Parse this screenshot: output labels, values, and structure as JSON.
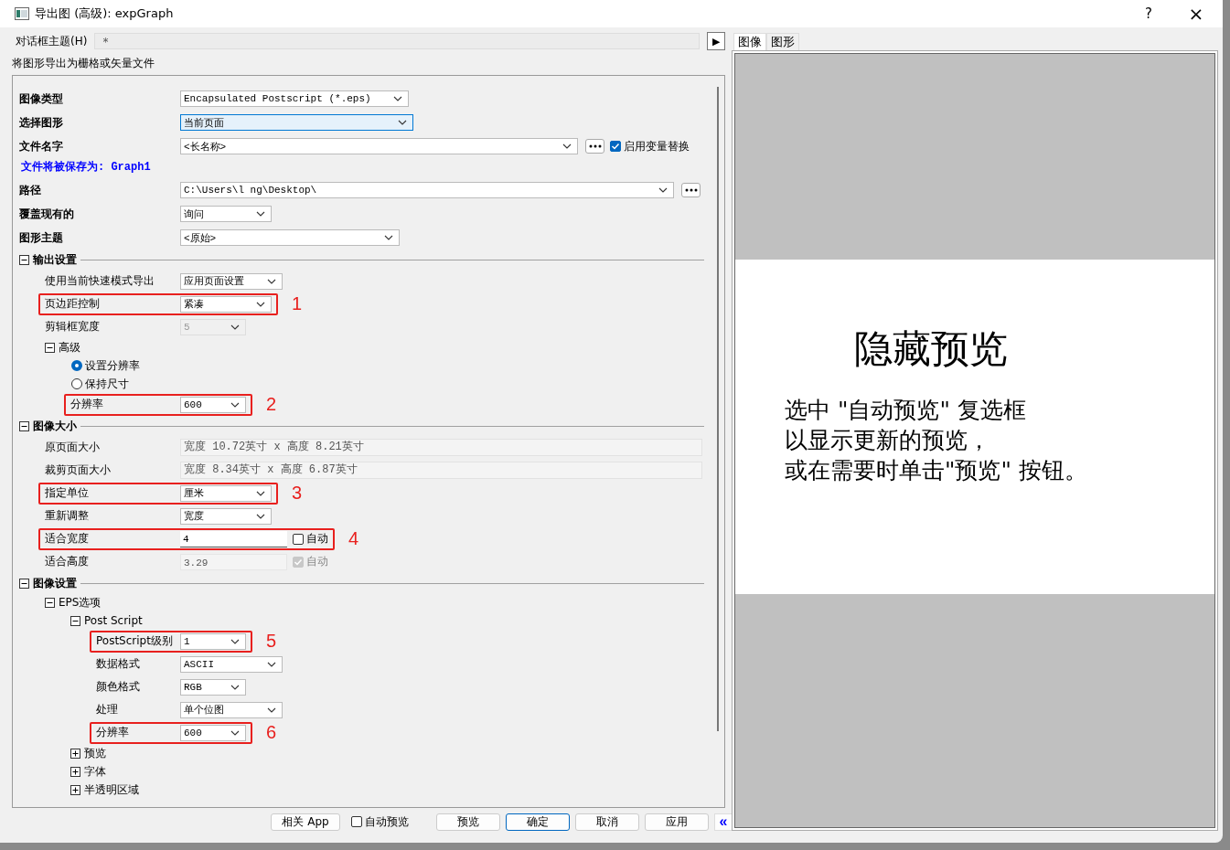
{
  "window": {
    "title": "导出图 (高级): expGraph",
    "help_button": "?",
    "close_button": "×"
  },
  "theme_row": {
    "label": "对话框主题(H)",
    "value": "*",
    "arrow": "▶"
  },
  "description": "将图形导出为栅格或矢量文件",
  "fields": [
    {
      "kind": "dropdown",
      "label": "图像类型",
      "value": "Encapsulated Postscript (*.eps)",
      "focused": false
    },
    {
      "kind": "dropdown",
      "label": "选择图形",
      "value": "当前页面",
      "focused": true
    },
    {
      "kind": "browse",
      "label": "文件名字",
      "value": "<长名称>",
      "option": {
        "label": "启用变量替换",
        "checked": true
      }
    },
    {
      "kind": "note",
      "text": "文件将被保存为: Graph1"
    },
    {
      "kind": "browse",
      "label": "路径",
      "value": "C:\\Users\\l  ng\\Desktop\\"
    },
    {
      "kind": "dropdown",
      "label": "覆盖现有的",
      "value": "询问",
      "focused": false
    },
    {
      "kind": "dropdown",
      "label": "图形主题",
      "value": "<原始>",
      "focused": false
    }
  ],
  "tree": [
    {
      "kind": "group",
      "label": "输出设置",
      "expanded": true,
      "children": [
        {
          "kind": "dropdown",
          "label": "使用当前快速模式导出",
          "value": "应用页面设置",
          "disabled": false
        },
        {
          "kind": "dropdown",
          "label": "页边距控制",
          "value": "紧凑",
          "disabled": false,
          "callout": "1"
        },
        {
          "kind": "dropdown",
          "label": "剪辑框宽度",
          "value": "5",
          "disabled": true
        },
        {
          "kind": "group",
          "label": "高级",
          "expanded": true,
          "children": [
            {
              "kind": "radio",
              "label": "设置分辨率",
              "selected": true
            },
            {
              "kind": "radio",
              "label": "保持尺寸",
              "selected": false
            },
            {
              "kind": "dropdown",
              "label": "分辨率",
              "value": "600",
              "disabled": false,
              "callout": "2"
            }
          ]
        }
      ]
    },
    {
      "kind": "group",
      "label": "图像大小",
      "expanded": true,
      "children": [
        {
          "kind": "readonly",
          "label": "原页面大小",
          "value": "宽度 10.72英寸 x 高度 8.21英寸"
        },
        {
          "kind": "readonly",
          "label": "裁剪页面大小",
          "value": "宽度 8.34英寸 x 高度 6.87英寸"
        },
        {
          "kind": "dropdown",
          "label": "指定单位",
          "value": "厘米",
          "disabled": false,
          "callout": "3"
        },
        {
          "kind": "dropdown",
          "label": "重新调整",
          "value": "宽度",
          "disabled": false
        },
        {
          "kind": "input_check",
          "label": "适合宽度",
          "value": "4",
          "disabled": false,
          "check_label": "自动",
          "checked": false,
          "callout": "4"
        },
        {
          "kind": "input_check",
          "label": "适合高度",
          "value": "3.29",
          "disabled": true,
          "check_label": "自动",
          "checked": true
        }
      ]
    },
    {
      "kind": "group",
      "label": "图像设置",
      "expanded": true,
      "children": [
        {
          "kind": "group",
          "label": "EPS选项",
          "expanded": true,
          "children": [
            {
              "kind": "group",
              "label": "Post Script",
              "expanded": true,
              "children": [
                {
                  "kind": "dropdown",
                  "label": "PostScript级别",
                  "value": "1",
                  "disabled": false,
                  "callout": "5"
                },
                {
                  "kind": "dropdown",
                  "label": "数据格式",
                  "value": "ASCII",
                  "disabled": false
                },
                {
                  "kind": "dropdown",
                  "label": "颜色格式",
                  "value": "RGB",
                  "disabled": false
                },
                {
                  "kind": "dropdown",
                  "label": "处理",
                  "value": "单个位图",
                  "disabled": false
                },
                {
                  "kind": "dropdown",
                  "label": "分辨率",
                  "value": "600",
                  "disabled": false,
                  "callout": "6"
                }
              ]
            },
            {
              "kind": "group",
              "label": "预览",
              "expanded": false
            },
            {
              "kind": "group",
              "label": "字体",
              "expanded": false
            },
            {
              "kind": "group",
              "label": "半透明区域",
              "expanded": false
            }
          ]
        }
      ]
    }
  ],
  "footer": [
    {
      "kind": "button",
      "label": "相关 App",
      "default": false
    },
    {
      "kind": "checkbox",
      "label": "自动预览",
      "checked": false
    },
    {
      "kind": "button",
      "label": "预览",
      "default": false
    },
    {
      "kind": "button",
      "label": "确定",
      "default": true
    },
    {
      "kind": "button",
      "label": "取消",
      "default": false
    },
    {
      "kind": "button",
      "label": "应用",
      "default": false
    },
    {
      "kind": "toggle",
      "label": "«"
    }
  ],
  "preview": {
    "tabs": [
      {
        "label": "图像",
        "selected": true
      },
      {
        "label": "图形",
        "selected": false
      }
    ],
    "heading": "隐藏预览",
    "message": [
      "选中 \"自动预览\" 复选框",
      "以显示更新的预览，",
      "或在需要时单击\"预览\" 按钮。"
    ]
  }
}
